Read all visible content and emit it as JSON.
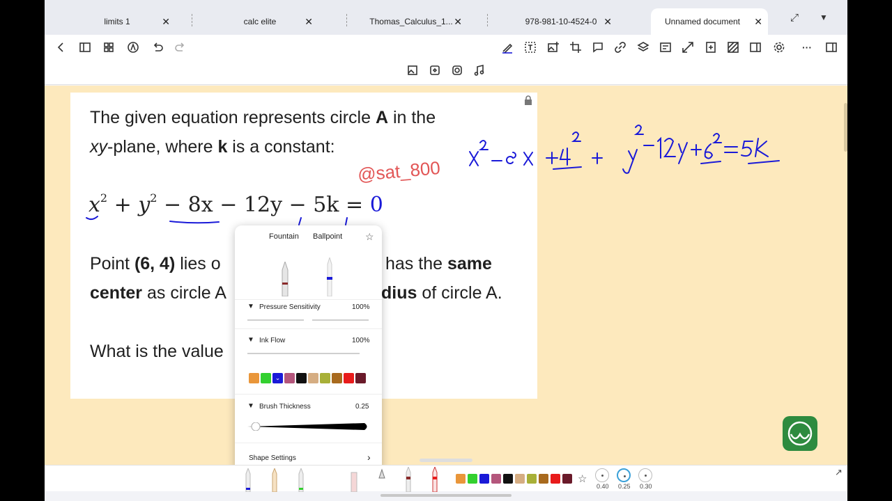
{
  "tabs": [
    {
      "label": "limits 1",
      "close": "✕"
    },
    {
      "label": "calc elite",
      "close": "✕"
    },
    {
      "label": "Thomas_Calculus_1...",
      "close": "✕"
    },
    {
      "label": "978-981-10-4524-0",
      "close": "✕"
    },
    {
      "label": "Unnamed document",
      "close": "✕"
    }
  ],
  "question": {
    "line1_pre": "The given equation represents circle ",
    "line1_bold": "A",
    "line1_post": " in the",
    "line2_italic": "xy",
    "line2_mid": "-plane, where ",
    "line2_bold": "k",
    "line2_post": " is a constant:",
    "equation": {
      "x": "x",
      "x_exp": "2",
      "plus1": " + ",
      "y": "y",
      "y_exp": "2",
      "rest": " − 8x − 12y − 5k = ",
      "rhs": "0"
    },
    "point_pre": "Point ",
    "point_bold": "(6, 4)",
    "point_visible": " lies o",
    "point_right": "has the ",
    "point_right_bold": "same",
    "center_bold": "center",
    "center_mid": " as circle A",
    "radius_bold": "dius",
    "radius_post": " of circle A.",
    "question_visible": "What is the value"
  },
  "watermark": "@sat_800",
  "handwriting": {
    "note": "x² − 8x + 4² + y² − 12y + 6² = 5k"
  },
  "pen_popup": {
    "tab_fountain": "Fountain",
    "tab_ballpoint": "Ballpoint",
    "pressure_label": "Pressure Sensitivity",
    "pressure_value": "100%",
    "inkflow_label": "Ink Flow",
    "inkflow_value": "100%",
    "thickness_label": "Brush Thickness",
    "thickness_value": "0.25",
    "shape_settings_label": "Shape Settings",
    "colors": [
      "#e9963a",
      "#33d02f",
      "#1a1ad8",
      "#b4567c",
      "#111111",
      "#d5ad82",
      "#a8b038",
      "#a86a1e",
      "#e81b1b",
      "#6a1a2a"
    ],
    "selected_color_index": 2
  },
  "bottom_tray": {
    "colors": [
      "#e9963a",
      "#33d02f",
      "#1a1ad8",
      "#b4567c",
      "#111111",
      "#d5ad82",
      "#a8b038",
      "#a86a1e",
      "#e81b1b",
      "#6a1a2a"
    ],
    "sizes": [
      "0.40",
      "0.25",
      "0.30"
    ]
  }
}
